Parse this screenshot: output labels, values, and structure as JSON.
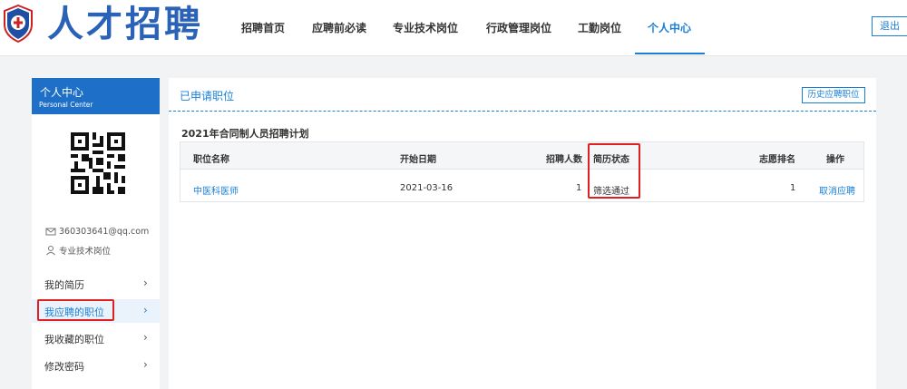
{
  "header": {
    "brand": "人才招聘",
    "nav": [
      {
        "label": "招聘首页"
      },
      {
        "label": "应聘前必读"
      },
      {
        "label": "专业技术岗位"
      },
      {
        "label": "行政管理岗位"
      },
      {
        "label": "工勤岗位"
      },
      {
        "label": "个人中心",
        "active": true
      }
    ],
    "logout": "退出"
  },
  "sidebar": {
    "title": "个人中心",
    "subtitle": "Personal Center",
    "email": "360303641@qq.com",
    "position_type": "专业技术岗位",
    "menu": [
      {
        "label": "我的简历"
      },
      {
        "label": "我应聘的职位",
        "active": true
      },
      {
        "label": "我收藏的职位"
      },
      {
        "label": "修改密码"
      }
    ]
  },
  "main": {
    "title": "已申请职位",
    "history_button": "历史应聘职位",
    "plan_title": "2021年合同制人员招聘计划",
    "table": {
      "headers": [
        "职位名称",
        "开始日期",
        "招聘人数",
        "简历状态",
        "志愿排名",
        "操作"
      ],
      "rows": [
        {
          "position": "中医科医师",
          "start_date": "2021-03-16",
          "count": "1",
          "status": "筛选通过",
          "rank": "1",
          "action": "取消应聘"
        }
      ]
    }
  },
  "colors": {
    "accent": "#1a7fd8",
    "sidebar_header": "#1e6fc8",
    "highlight": "#e02020",
    "background": "#f2f3f5"
  },
  "icons": {
    "logo": "hospital-emblem",
    "email": "mail-icon",
    "user": "user-icon",
    "menu_arrow": "chevron-right-icon"
  }
}
